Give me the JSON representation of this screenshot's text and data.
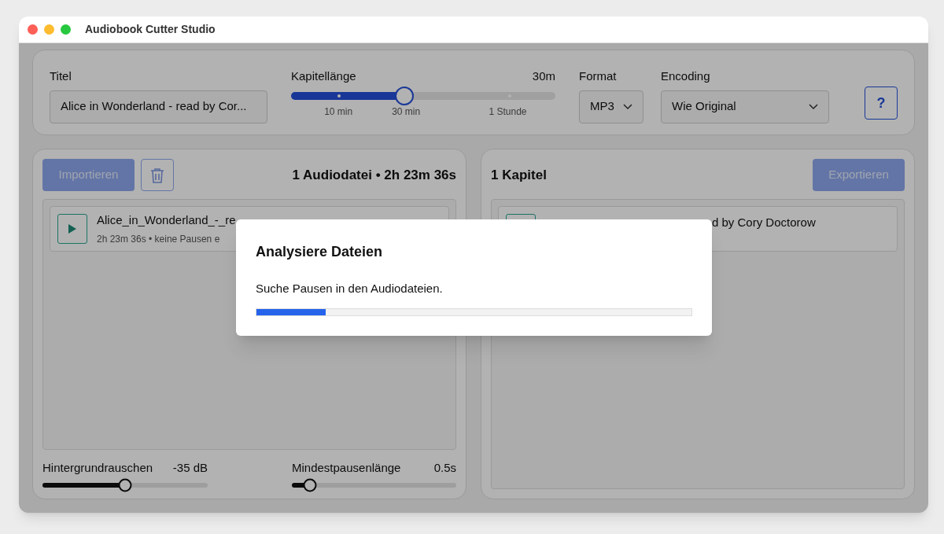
{
  "window": {
    "title": "Audiobook Cutter Studio"
  },
  "settings": {
    "title_label": "Titel",
    "title_value": "Alice in Wonderland - read by Cor...",
    "chapter_length": {
      "label": "Kapitellänge",
      "reading": "30m",
      "level": 0.43,
      "ticks": [
        "10 min",
        "30 min",
        "1 Stunde"
      ]
    },
    "format": {
      "label": "Format",
      "value": "MP3"
    },
    "encoding": {
      "label": "Encoding",
      "value": "Wie Original"
    },
    "help": "?"
  },
  "files_panel": {
    "import_button": {
      "label": "Importieren",
      "disabled": true
    },
    "summary": "1 Audiodatei • 2h 23m 36s",
    "files": [
      {
        "name": "Alice_in_Wonderland_-_re",
        "details": "2h 23m 36s • keine Pausen e"
      }
    ],
    "sliders": [
      {
        "label": "Hintergrundrauschen",
        "reading": "-35 dB",
        "level": 0.5
      },
      {
        "label": "Mindestpausenlänge",
        "reading": "0.5s",
        "level": 0.11
      }
    ]
  },
  "chapters_panel": {
    "summary": "1 Kapitel",
    "export_button": {
      "label": "Exportieren",
      "disabled": true
    },
    "chapters": [
      {
        "title": "d by Cory Doctorow"
      }
    ]
  },
  "dialog": {
    "title": "Analysiere Dateien",
    "message": "Suche Pausen in den Audiodateien.",
    "level": 0.16
  }
}
